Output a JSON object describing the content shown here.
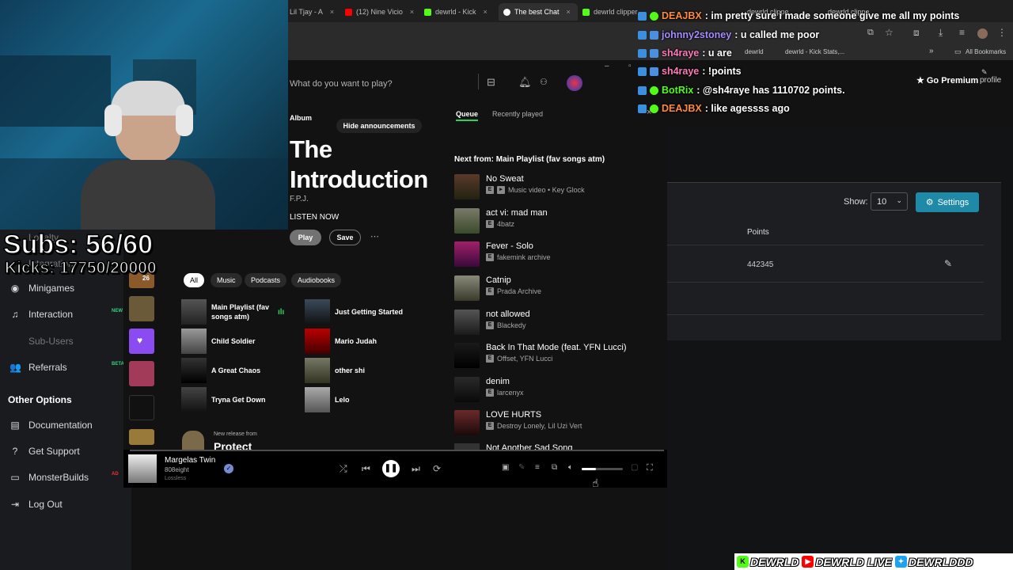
{
  "browser": {
    "tabs": [
      {
        "label": "Lil Tjay - A",
        "color": "#d9d9d9"
      },
      {
        "label": "(12) Nine Vicio",
        "color": "#ff0000"
      },
      {
        "label": "dewrld - Kick",
        "color": "#53fc18"
      },
      {
        "label": "The best Chat",
        "color": "#ffffff"
      },
      {
        "label": "dewrld clipper",
        "color": "#53fc18"
      },
      {
        "label": "dewrld clippe",
        "color": "#53fc18"
      },
      {
        "label": "dewrld clippe",
        "color": "#53fc18"
      }
    ],
    "bookmarks": [
      "dewrld",
      "dewrld - Kick Stats,..."
    ],
    "all_bookmarks": "All Bookmarks"
  },
  "chat": [
    {
      "user": "DEAJBX",
      "user_color": "#ff8a3d",
      "msg": "im pretty sure i made someone give me all my points"
    },
    {
      "user": "johnny2stoney",
      "user_color": "#a58cff",
      "msg": "u called me poor"
    },
    {
      "user": "sh4raye",
      "user_color": "#ff7ab8",
      "msg": "u are"
    },
    {
      "user": "sh4raye",
      "user_color": "#ff7ab8",
      "msg": "!points"
    },
    {
      "user": "BotRix",
      "user_color": "#53fc18",
      "msg": "@sh4raye has 1110702 points."
    },
    {
      "user": "DEAJBX",
      "user_color": "#ff8a3d",
      "msg": "like agessss ago"
    }
  ],
  "overlay": {
    "subs": "Subs: 56/60",
    "kicks": "Kicks: 17750/20000"
  },
  "spotify": {
    "search_placeholder": "What do you want to play?",
    "hide_announcements": "Hide announcements",
    "album_label": "Album",
    "album_title_line1": "The",
    "album_title_line2": "Introduction",
    "album_artist": "F.P.J.",
    "listen_now": "LISTEN NOW",
    "play": "Play",
    "save": "Save",
    "go_premium": "Go Premium",
    "profile": "profile",
    "filters": [
      "All",
      "Music",
      "Podcasts",
      "Audiobooks"
    ],
    "grid": [
      {
        "title": "Main Playlist (fav songs atm)"
      },
      {
        "title": "Just Getting Started"
      },
      {
        "title": "Child Soldier"
      },
      {
        "title": "Mario Judah"
      },
      {
        "title": "A Great Chaos"
      },
      {
        "title": "other shi"
      },
      {
        "title": "Tryna Get Down"
      },
      {
        "title": "Lelo"
      }
    ],
    "new_release_label": "New release from",
    "new_release_title": "Protect",
    "lib_badge": "26",
    "queue_tab": "Queue",
    "recent_tab": "Recently played",
    "next_from": "Next from: Main Playlist (fav songs atm)",
    "queue": [
      {
        "title": "No Sweat",
        "sub": "Music video • Key Glock",
        "video": true
      },
      {
        "title": "act vi: mad man",
        "sub": "4batz"
      },
      {
        "title": "Fever - Solo",
        "sub": "fakemink archive"
      },
      {
        "title": "Catnip",
        "sub": "Prada Archive"
      },
      {
        "title": "not allowed",
        "sub": "Blackedy"
      },
      {
        "title": "Back In That Mode (feat. YFN Lucci)",
        "sub": "Offset, YFN Lucci"
      },
      {
        "title": "denim",
        "sub": "larcenyx"
      },
      {
        "title": "LOVE HURTS",
        "sub": "Destroy Lonely, Lil Uzi Vert"
      },
      {
        "title": "Not Another Sad Song",
        "sub": ""
      }
    ],
    "now_playing": {
      "title": "Margelas Twin",
      "artist": "808eight",
      "quality": "Lossless"
    },
    "volume": 0.35,
    "progress": 0.0
  },
  "dashboard": {
    "sidebar": [
      {
        "label": "Loyalty",
        "icon": "star-icon",
        "dim": true
      },
      {
        "label": "Integrations",
        "icon": "plug-icon",
        "dim": true
      },
      {
        "label": "Minigames",
        "icon": "gamepad-icon"
      },
      {
        "label": "Interaction",
        "icon": "music-icon",
        "tag": "NEW"
      },
      {
        "label": "Sub-Users",
        "icon": "users-icon",
        "dim": true
      },
      {
        "label": "Referrals",
        "icon": "referrals-icon",
        "tag": "BETA"
      }
    ],
    "other_options_heading": "Other Options",
    "other_options": [
      {
        "label": "Documentation",
        "icon": "document-icon"
      },
      {
        "label": "Get Support",
        "icon": "question-icon"
      },
      {
        "label": "MonsterBuilds",
        "icon": "laptop-icon",
        "tag": "AD"
      },
      {
        "label": "Log Out",
        "icon": "logout-icon"
      }
    ],
    "show_label": "Show:",
    "show_value": "10",
    "settings_button": "Settings",
    "points_header": "Points",
    "points_value": "442345"
  },
  "socials": [
    {
      "platform": "kick",
      "handle": "DEWRLD",
      "color": "#53fc18"
    },
    {
      "platform": "youtube",
      "handle": "DEWRLD LIVE",
      "color": "#ff0000"
    },
    {
      "platform": "twitter",
      "handle": "DEWRLDDD",
      "color": "#1da1f2"
    }
  ]
}
